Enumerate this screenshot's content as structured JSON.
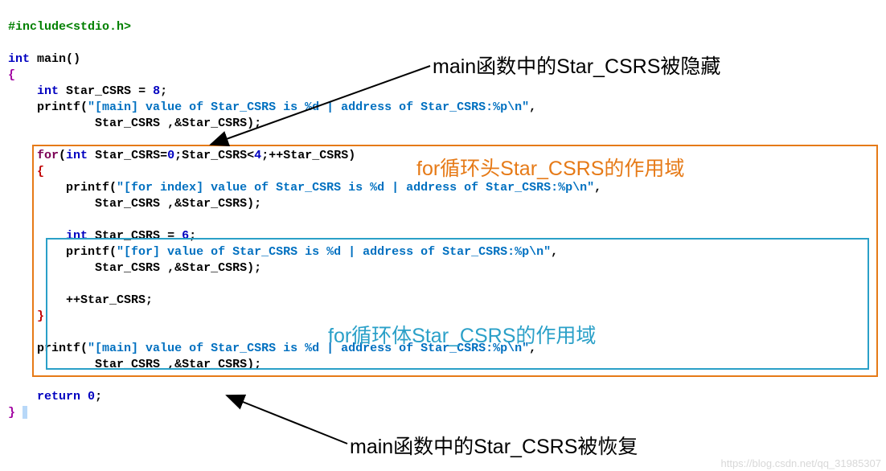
{
  "code": {
    "include": "#include<stdio.h>",
    "int": "int",
    "main": "main",
    "lpar": "(",
    "rpar": ")",
    "lbr": "{",
    "rbr": "}",
    "var": "Star_CSRS",
    "eq": " = ",
    "eight": "8",
    "six": "6",
    "zero": "0",
    "four": "4",
    "semi": ";",
    "printf": "printf",
    "str_main": "\"[main] value of Star_CSRS is %d | address of Star_CSRS:%p\\n\"",
    "str_foridx": "\"[for index] value of Star_CSRS is %d | address of Star_CSRS:%p\\n\"",
    "str_for": "\"[for] value of Star_CSRS is %d | address of Star_CSRS:%p\\n\"",
    "comma": ",",
    "amp": "&",
    "forkw": "for",
    "lt": "<",
    "plusplus": "++",
    "return": "return"
  },
  "annotations": {
    "top_black": "main函数中的Star_CSRS被隐藏",
    "orange": "for循环头Star_CSRS的作用域",
    "cyan": "for循环体Star_CSRS的作用域",
    "bottom_black": "main函数中的Star_CSRS被恢复"
  },
  "watermark": "https://blog.csdn.net/qq_31985307"
}
